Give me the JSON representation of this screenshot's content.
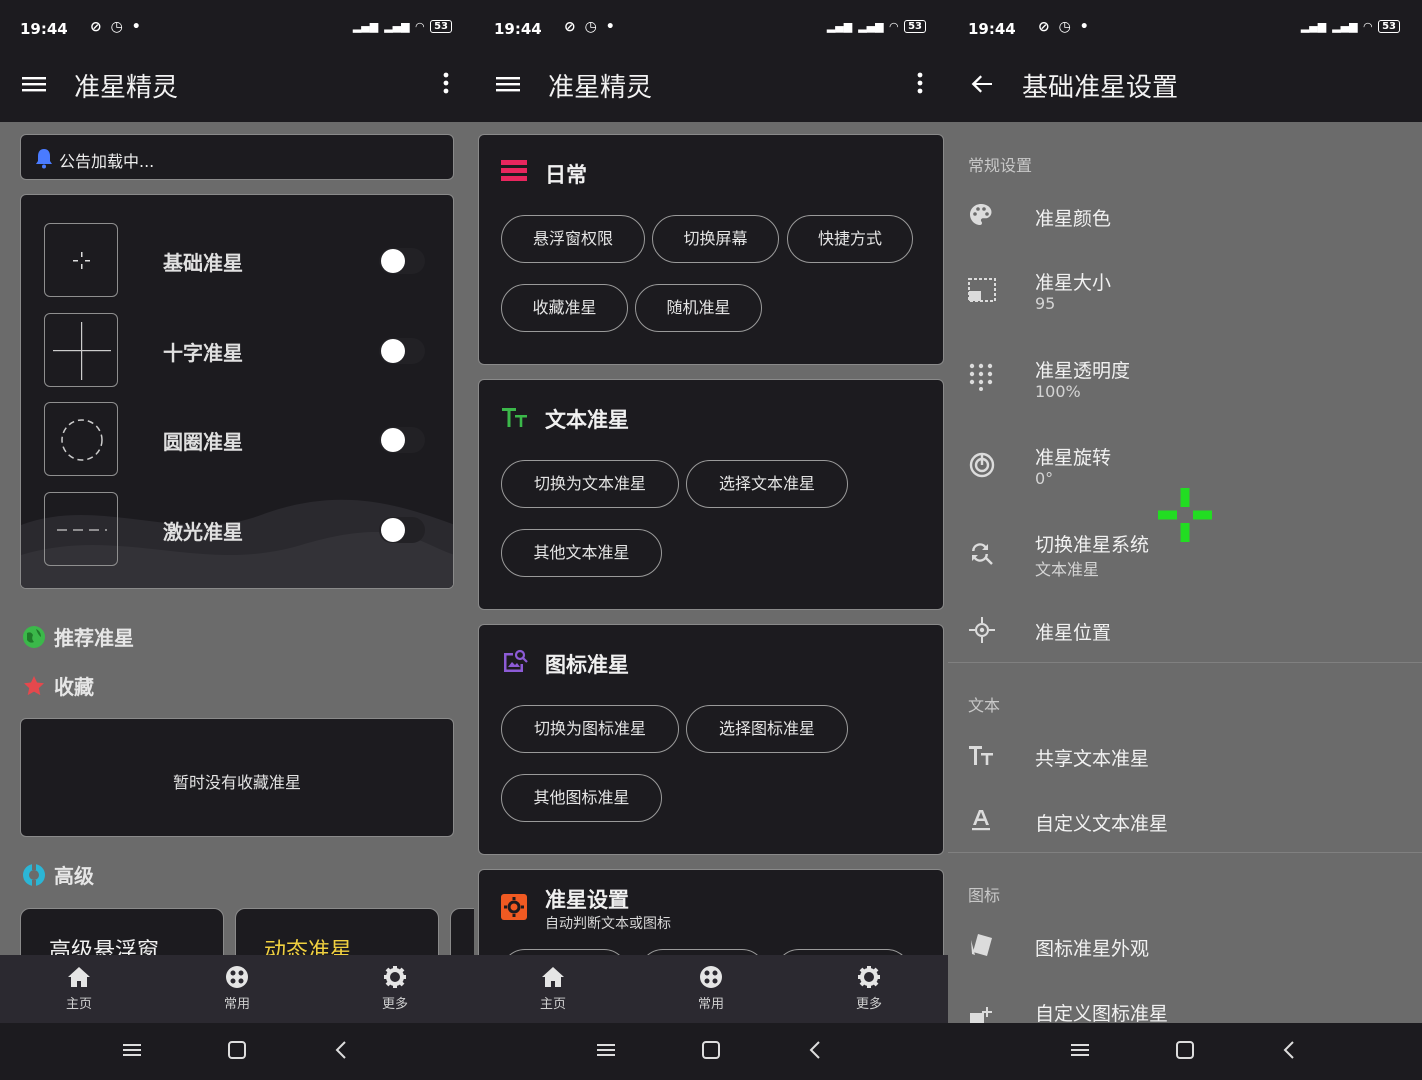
{
  "status": {
    "time": "19:44",
    "battery": "53"
  },
  "screen1": {
    "title": "准星精灵",
    "notice": "公告加载中...",
    "aims": [
      {
        "label": "基础准星"
      },
      {
        "label": "十字准星"
      },
      {
        "label": "圆圈准星"
      },
      {
        "label": "激光准星"
      }
    ],
    "recommended": "推荐准星",
    "favorites": "收藏",
    "empty_favorites": "暂时没有收藏准星",
    "advanced": "高级",
    "adv_cards": [
      "高级悬浮窗",
      "动态准星"
    ]
  },
  "screen2": {
    "title": "准星精灵",
    "groups": [
      {
        "title": "日常",
        "chips": [
          "悬浮窗权限",
          "切换屏幕",
          "快捷方式",
          "收藏准星",
          "随机准星"
        ]
      },
      {
        "title": "文本准星",
        "chips": [
          "切换为文本准星",
          "选择文本准星",
          "其他文本准星"
        ]
      },
      {
        "title": "图标准星",
        "chips": [
          "切换为图标准星",
          "选择图标准星",
          "其他图标准星"
        ]
      },
      {
        "title": "准星设置",
        "subtitle": "自动判断文本或图标"
      }
    ]
  },
  "screen3": {
    "title": "基础准星设置",
    "general_header": "常规设置",
    "general": [
      {
        "title": "准星颜色",
        "icon": "palette-icon"
      },
      {
        "title": "准星大小",
        "summary": "95",
        "icon": "resize-icon"
      },
      {
        "title": "准星透明度",
        "summary": "100%",
        "icon": "dots-grid-icon"
      },
      {
        "title": "准星旋转",
        "summary": "0°",
        "icon": "rotate-icon"
      },
      {
        "title": "切换准星系统",
        "summary": "文本准星",
        "icon": "switch-icon"
      },
      {
        "title": "准星位置",
        "icon": "crosshair-icon"
      }
    ],
    "text_header": "文本",
    "text_items": [
      {
        "title": "共享文本准星",
        "icon": "text-size-icon"
      },
      {
        "title": "自定义文本准星",
        "icon": "text-format-icon"
      }
    ],
    "icon_header": "图标",
    "icon_items": [
      {
        "title": "图标准星外观",
        "icon": "cards-icon"
      },
      {
        "title": "自定义图标准星",
        "icon": "add-image-icon"
      }
    ]
  },
  "bottom_nav": [
    {
      "label": "主页",
      "icon": "home-icon"
    },
    {
      "label": "常用",
      "icon": "apps-icon"
    },
    {
      "label": "更多",
      "icon": "gear-icon"
    }
  ],
  "colors": {
    "accent_red": "#e8265e",
    "accent_green": "#3bb84a",
    "accent_purple": "#8c5bd6",
    "accent_orange": "#f05a22",
    "crosshair_green": "#22dd22"
  }
}
